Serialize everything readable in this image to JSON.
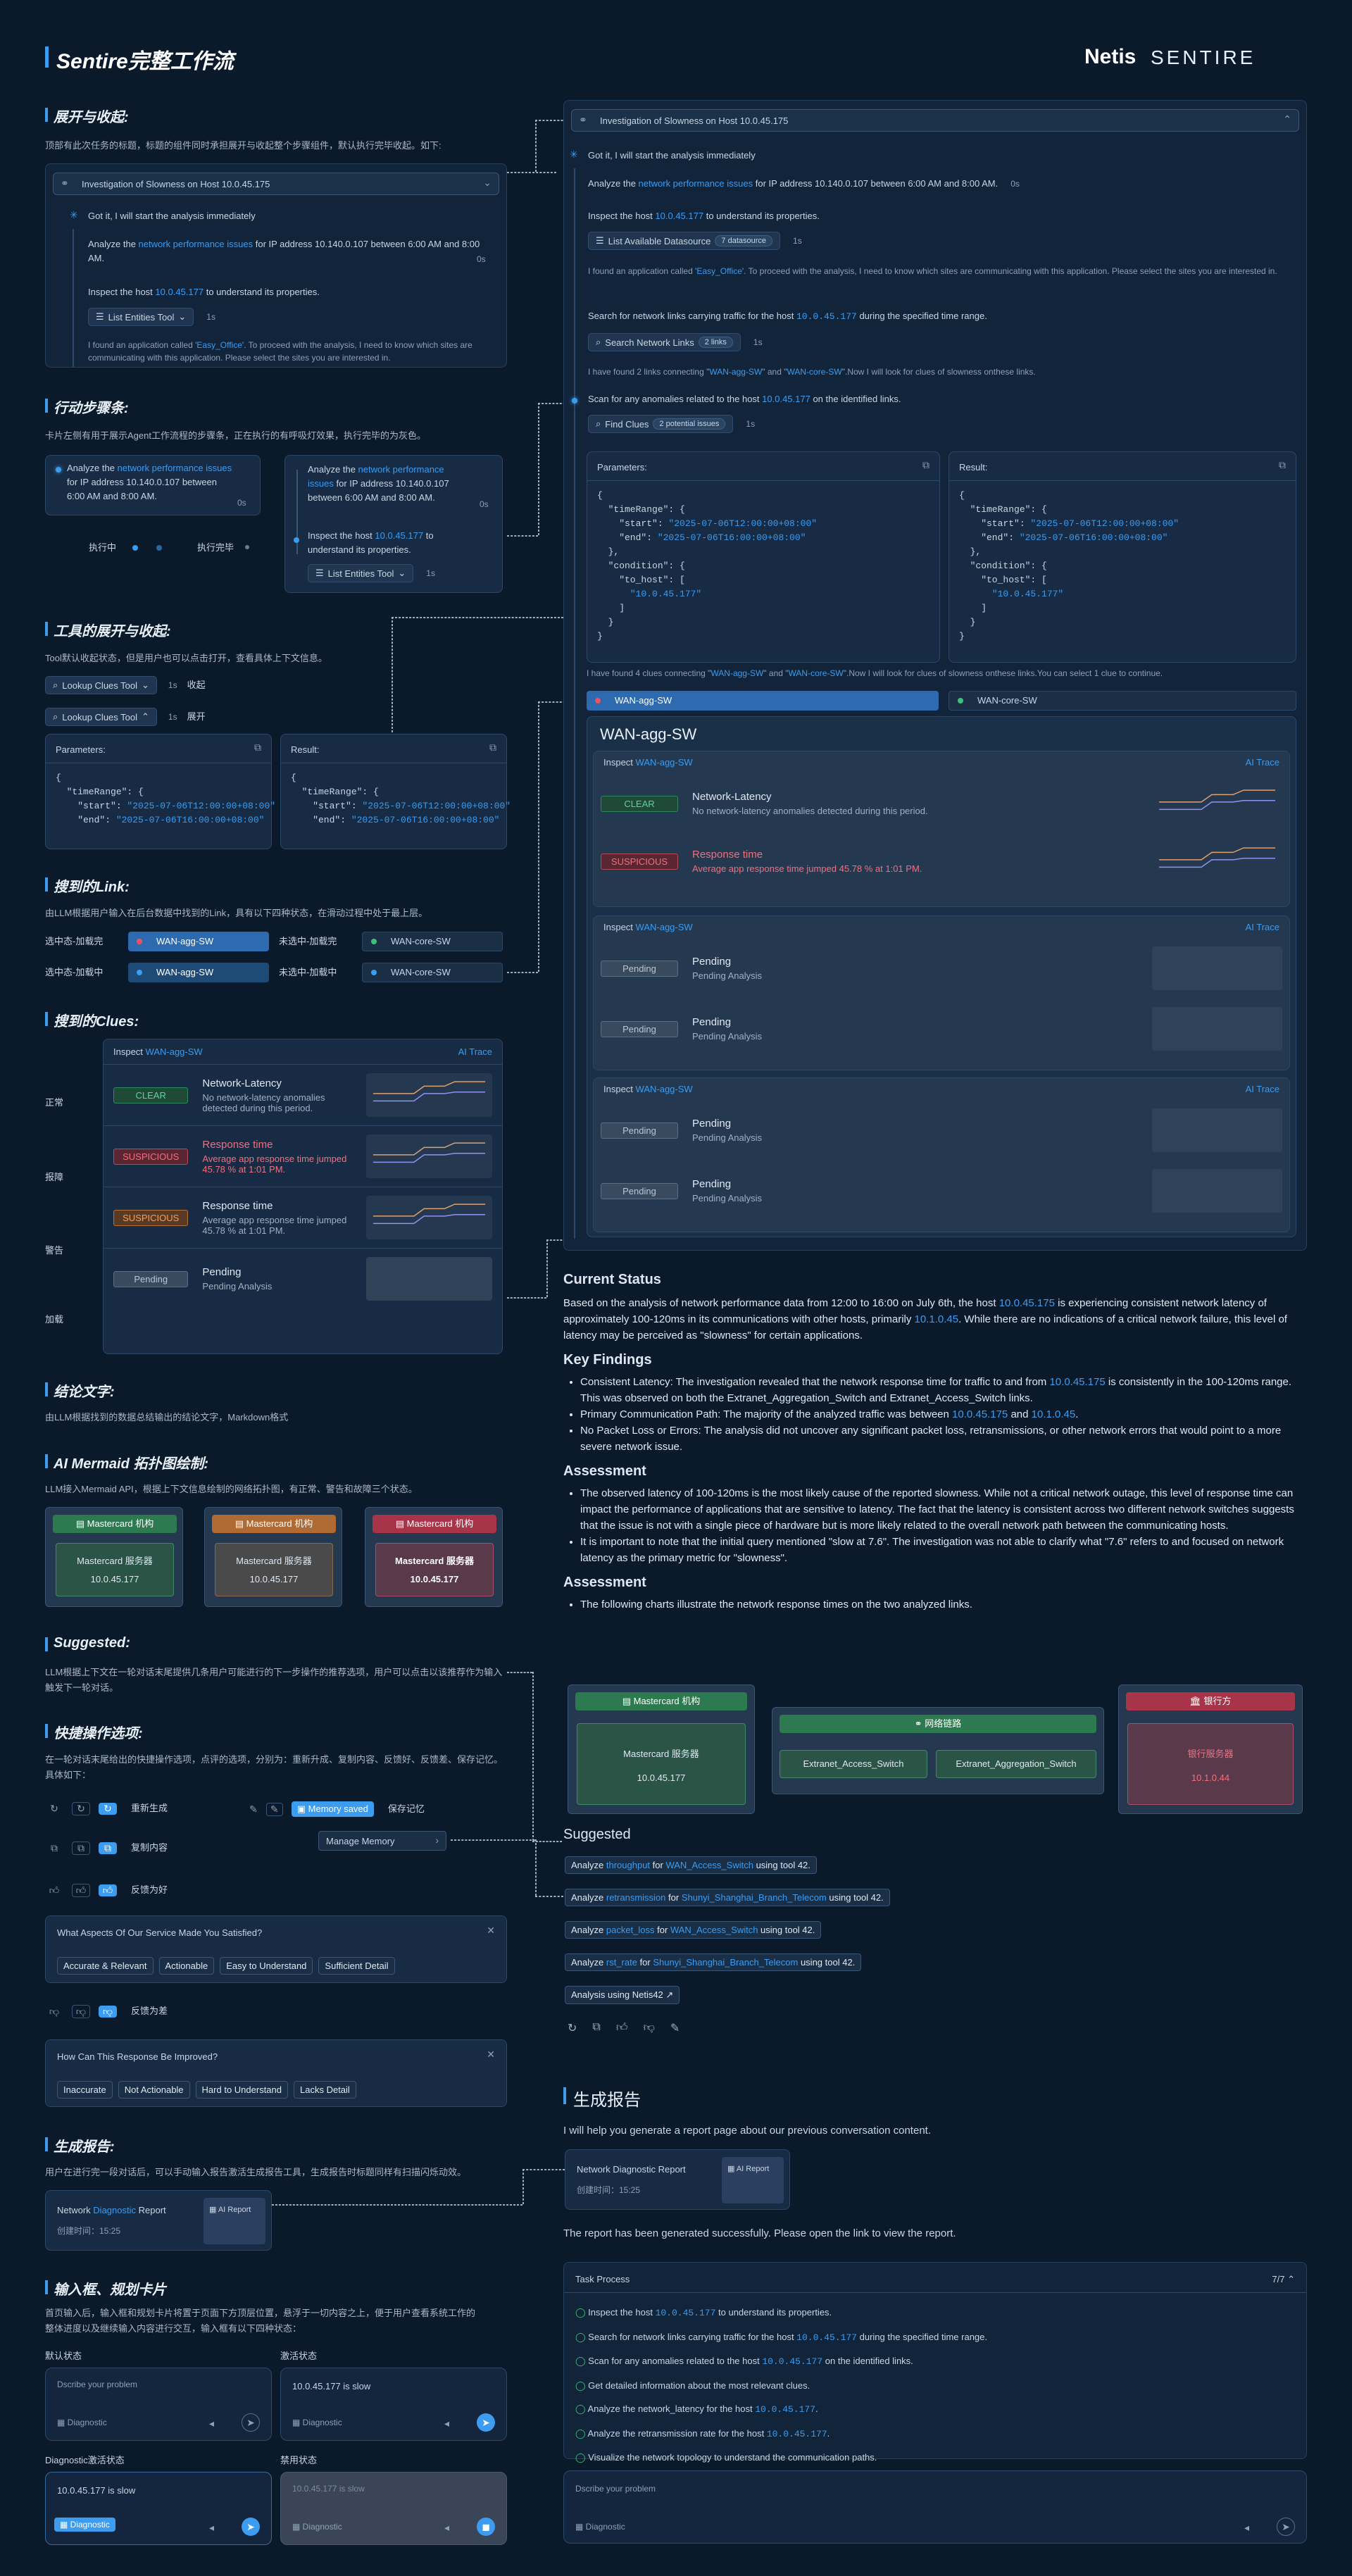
{
  "header": {
    "title": "Sentire完整工作流",
    "logo_netis": "Netis",
    "logo_sentire": "SENTIRE"
  },
  "colors": {
    "bg": "#0b1a2b",
    "accent": "#3b9cf0",
    "clear": "#5fd39a",
    "suspicious": "#f07080",
    "warning": "#f0a060"
  },
  "sec1": {
    "title": "展开与收起:",
    "desc": "顶部有此次任务的标题，标题的组件同时承担展开与收起整个步骤组件，默认执行完毕收起。如下:",
    "card_title": "Investigation of Slowness on Host 10.0.45.175",
    "got": "Got it, I will start the analysis immediately",
    "step1_a": "Analyze the ",
    "step1_link": "network performance issues",
    "step1_b": " for IP address 10.140.0.107 between 6:00 AM and 8:00 AM.",
    "step1_time": "0s",
    "step2_a": "Inspect the host ",
    "step2_link": "10.0.45.177",
    "step2_b": " to understand its properties.",
    "tool": "List Entities Tool",
    "tool_time": "1s",
    "found_a": "I found an application called '",
    "found_link": "Easy_Office",
    "found_b": "'. To proceed with the analysis, I need to know which sites are communicating with this application. Please select the sites you are interested in."
  },
  "sec2": {
    "title": "行动步骤条:",
    "desc": "卡片左侧有用于展示Agent工作流程的步骤条，正在执行的有呼吸灯效果，执行完毕的为灰色。",
    "running": "执行中",
    "done": "执行完毕",
    "time": "0s",
    "tool_time": "1s"
  },
  "sec3": {
    "title": "工具的展开与收起:",
    "desc": "Tool默认收起状态，但是用户也可以点击打开，查看具体上下文信息。",
    "tool": "Lookup Clues Tool",
    "time": "1s",
    "collapsed": "收起",
    "expanded": "展开",
    "params": "Parameters:",
    "result": "Result:"
  },
  "json_line1": "{",
  "json_line2": "  \"timeRange\": {",
  "json_start_k": "    \"start\": ",
  "json_start_v": "\"2025-07-06T12:00:00+08:00\"",
  "json_end_k": "    \"end\": ",
  "json_end_v": "\"2025-07-06T16:00:00+08:00\"",
  "sec4": {
    "title": "搜到的Link:",
    "desc": "由LLM根据用户输入在后台数据中找到的Link，具有以下四种状态，在滑动过程中处于最上层。",
    "sel_loaded": "选中态-加载完",
    "unsel_loaded": "未选中-加载完",
    "sel_loading": "选中态-加载中",
    "unsel_loading": "未选中-加载中",
    "link_a": "WAN-agg-SW",
    "link_b": "WAN-core-SW"
  },
  "sec5": {
    "title": "搜到的Clues:",
    "inspect": "Inspect",
    "target": "WAN-agg-SW",
    "ai_trace": "AI Trace",
    "normal": "正常",
    "error": "报障",
    "warn": "警告",
    "loading": "加载",
    "clear": "CLEAR",
    "suspicious": "SUSPICIOUS",
    "pending": "Pending",
    "c1_t": "Network-Latency",
    "c1_s": "No network-latency anomalies detected during this period.",
    "c2_t": "Response time",
    "c2_s": "Average app response time jumped 45.78 % at 1:01 PM.",
    "c4_t": "Pending",
    "c4_s": "Pending Analysis"
  },
  "sec6": {
    "title": "结论文字:",
    "desc": "由LLM根据找到的数据总结输出的结论文字，Markdown格式"
  },
  "sec7": {
    "title": "AI Mermaid 拓扑图绘制:",
    "desc": "LLM接入Mermaid API，根据上下文信息绘制的网络拓扑图，有正常、警告和故障三个状态。",
    "node_title": "Mastercard 机构",
    "server": "Mastercard 服务器",
    "ip": "10.0.45.177"
  },
  "sec8": {
    "title": "Suggested:",
    "desc": "LLM根据上下文在一轮对话末尾提供几条用户可能进行的下一步操作的推荐选项，用户可以点击以该推荐作为输入触发下一轮对话。"
  },
  "sec9": {
    "title": "快捷操作选项:",
    "desc": "在一轮对话末尾给出的快捷操作选项，点评的选项，分别为：重新升成、复制内容、反馈好、反馈差、保存记忆。具体如下：",
    "regen": "重新生成",
    "copy": "复制内容",
    "good": "反馈为好",
    "bad": "反馈为差",
    "memory_saved": "Memory saved",
    "save_memory": "保存记忆",
    "manage_memory": "Manage Memory",
    "satisfied_q": "What Aspects Of Our Service Made You Satisfied?",
    "sat_opts": [
      "Accurate & Relevant",
      "Actionable",
      "Easy to Understand",
      "Sufficient Detail"
    ],
    "improve_q": "How Can This Response Be Improved?",
    "imp_opts": [
      "Inaccurate",
      "Not Actionable",
      "Hard to Understand",
      "Lacks Detail"
    ]
  },
  "sec10": {
    "title": "生成报告:",
    "desc": "用户在进行完一段对话后，可以手动输入报告激活生成报告工具，生成报告时标题同样有扫描闪烁动效。",
    "report_a": "Network ",
    "report_link": "Diagnostic",
    "report_b": " Report",
    "created": "创建时间：15:25",
    "ai_report": "AI Report"
  },
  "sec11": {
    "title": "输入框、规划卡片",
    "desc1": "首页输入后，输入框和规划卡片将置于页面下方顶层位置，悬浮于一切内容之上，便于用户查看系统工作的",
    "desc2": "整体进度以及继续输入内容进行交互，输入框有以下四种状态：",
    "default": "默认状态",
    "active": "激活状态",
    "diag_active": "Diagnostic激活状态",
    "disabled": "禁用状态",
    "placeholder": "Dscribe your problem",
    "value": "10.0.45.177 is slow",
    "diagnostic": "Diagnostic"
  },
  "right": {
    "title": "Investigation of Slowness on Host 10.0.45.175",
    "got": "Got it, I will start the analysis immediately",
    "s1_a": "Analyze the ",
    "s1_link": "network performance issues",
    "s1_b": " for IP address 10.140.0.107 between 6:00 AM and 8:00 AM.",
    "s1_time": "0s",
    "s2_a": "Inspect the host ",
    "s2_link": "10.0.45.177",
    "s2_b": " to understand its properties.",
    "ds": "List Available Datasource",
    "ds_tag": "7 datasource",
    "ds_time": "1s",
    "found_a": "I found an application called '",
    "found_link": "Easy_Office",
    "found_b": "'. To proceed with the analysis, I need to know which sites are communicating with this application. Please select the sites you are interested in.",
    "s3_a": "Search for network links carrying traffic for the host ",
    "s3_mono": "10.0.45.177",
    "s3_b": " during the specified time range.",
    "search": "Search Network Links",
    "search_tag": "2 links",
    "search_time": "1s",
    "two_a": "I have found 2 links connecting \"",
    "two_l1": "WAN-agg-SW",
    "two_m": "\" and \"",
    "two_l2": "WAN-core-SW",
    "two_b": "\".Now I will look for clues of slowness onthese links.",
    "s4_a": "Scan for any anomalies related to the host ",
    "s4_link": "10.0.45.177",
    "s4_b": " on the identified links.",
    "find": "Find Clues",
    "find_tag": "2 potential issues",
    "find_time": "1s",
    "four_a": "I have found 4 clues connecting \"",
    "four_m": "\" and \"",
    "four_b": "\".Now I will look for clues of slowness onthese links.You can select 1 clue to continue.",
    "to_host_k": "    \"to_host\": [",
    "to_host_v": "      \"10.0.45.177\"",
    "big_title": "WAN-agg-SW"
  },
  "conclusion": {
    "h1": "Current Status",
    "p1_a": "Based on the analysis of network performance data from 12:00 to 16:00 on July 6th, the host ",
    "p1_l1": "10.0.45.175",
    "p1_b": " is experiencing consistent network latency of approximately 100-120ms in its communications with other hosts, primarily ",
    "p1_l2": "10.1.0.45",
    "p1_c": ". While there are no indications of a critical network failure, this level of latency may be perceived as \"slowness\" for certain applications.",
    "h2": "Key Findings",
    "k1_a": "Consistent Latency: The investigation revealed that the network response time for traffic to and from ",
    "k1_l": "10.0.45.175",
    "k1_b": " is consistently in the 100-120ms range. This was observed on both the Extranet_Aggregation_Switch and Extranet_Access_Switch links.",
    "k2_a": "Primary Communication Path: The majority of the analyzed traffic was between ",
    "k2_l1": "10.0.45.175",
    "k2_m": " and ",
    "k2_l2": "10.1.0.45",
    "k2_b": ".",
    "k3": "No Packet Loss or Errors: The analysis did not uncover any significant packet loss, retransmissions, or other network errors that would point to a more severe network issue.",
    "h3": "Assessment",
    "a1": "The observed latency of 100-120ms is the most likely cause of the reported slowness. While not a critical network outage, this level of response time can impact the performance of applications that are sensitive to latency. The fact that the latency is consistent across two different network switches suggests that the issue is not with a single piece of hardware but is more likely related to the overall network path between the communicating hosts.",
    "a2": "It is important to note that the initial query mentioned \"slow at 7.6\". The investigation was not able to clarify what \"7.6\" refers to and focused on network latency as the primary metric for \"slowness\".",
    "h4": "Assessment",
    "b1": "The following charts illustrate the network response times on the two analyzed links.",
    "n1_title": "Mastercard 机构",
    "n1_server": "Mastercard 服务器",
    "n1_ip": "10.0.45.177",
    "n2_title": "网络链路",
    "n2_a": "Extranet_Access_Switch",
    "n2_b": "Extranet_Aggregation_Switch",
    "n3_title": "银行方",
    "n3_server": "银行服务器",
    "n3_ip": "10.1.0.44"
  },
  "suggested": {
    "title": "Suggested",
    "analyze": "Analyze ",
    "for": " for ",
    "using": " using tool 42.",
    "items": [
      {
        "m": "throughput",
        "t": "WAN_Access_Switch"
      },
      {
        "m": "retransmission",
        "t": "Shunyi_Shanghai_Branch_Telecom"
      },
      {
        "m": "packet_loss",
        "t": "WAN_Access_Switch"
      },
      {
        "m": "rst_rate",
        "t": "Shunyi_Shanghai_Branch_Telecom"
      }
    ],
    "netis": "Analysis using Netis42"
  },
  "report": {
    "title": "生成报告",
    "intro": "I will help you generate a report page about our previous conversation content.",
    "done": "The report has been generated successfully. Please open the link to view the report.",
    "card": "Network Diagnostic Report",
    "created": "创建时间：15:25",
    "ai_report": "AI Report"
  },
  "task": {
    "title": "Task Process",
    "count": "7/7",
    "t1_a": "Inspect the host ",
    "t1_m": "10.0.45.177",
    "t1_b": " to understand its properties.",
    "t2_a": "Search for network links carrying traffic for the host ",
    "t2_m": "10.0.45.177",
    "t2_b": " during the specified time range.",
    "t3_a": "Scan for any anomalies related to the host ",
    "t3_m": "10.0.45.177",
    "t3_b": " on the identified links.",
    "t4": "Get detailed information about the most relevant clues.",
    "t5_a": "Analyze the network_latency for the host ",
    "t5_m": "10.0.45.177",
    "t5_b": ".",
    "t6_a": "Analyze the retransmission rate for the host ",
    "t6_m": "10.0.45.177",
    "t6_b": ".",
    "t7": "Visualize the network topology to understand the communication paths.",
    "placeholder": "Dscribe your problem",
    "diagnostic": "Diagnostic"
  }
}
